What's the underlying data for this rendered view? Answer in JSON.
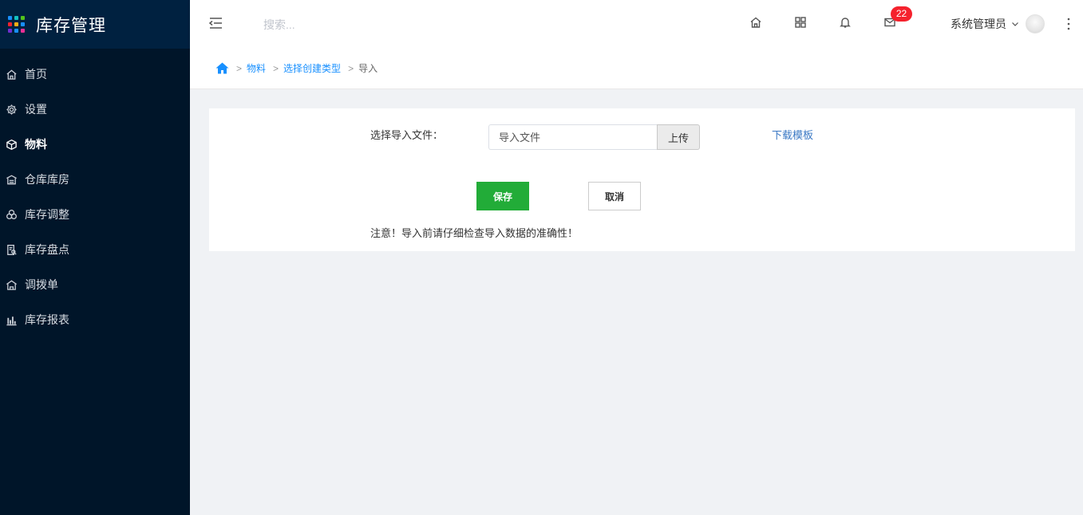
{
  "brand": {
    "title": "库存管理",
    "grid_colors": [
      "#1890ff",
      "#13c2c2",
      "#52c41a",
      "#f5222d",
      "#faad14",
      "#1890ff",
      "#722ed1",
      "#1890ff",
      "#eb2f96"
    ]
  },
  "sidebar": {
    "items": [
      {
        "label": "首页",
        "icon": "home-icon"
      },
      {
        "label": "设置",
        "icon": "gear-icon"
      },
      {
        "label": "物料",
        "icon": "box-icon",
        "active": true
      },
      {
        "label": "仓库库房",
        "icon": "warehouse-icon"
      },
      {
        "label": "库存调整",
        "icon": "adjust-icon"
      },
      {
        "label": "库存盘点",
        "icon": "inventory-check-icon"
      },
      {
        "label": "调拨单",
        "icon": "transfer-icon"
      },
      {
        "label": "库存报表",
        "icon": "bar-chart-icon"
      }
    ]
  },
  "header": {
    "search_placeholder": "搜索...",
    "message_badge": "22",
    "user_name": "系统管理员"
  },
  "breadcrumb": {
    "items": [
      "物料",
      "选择创建类型"
    ],
    "current": "导入"
  },
  "form": {
    "file_label": "选择导入文件：",
    "file_placeholder": "导入文件",
    "upload_label": "上传",
    "download_template": "下载模板",
    "save_label": "保存",
    "cancel_label": "取消",
    "note": "注意！导入前请仔细检查导入数据的准确性！"
  },
  "colors": {
    "sidebar_bg": "#001529",
    "brand_bg": "#002140",
    "primary": "#1890ff",
    "save_green": "#22ac38",
    "badge_red": "#f5222d"
  }
}
